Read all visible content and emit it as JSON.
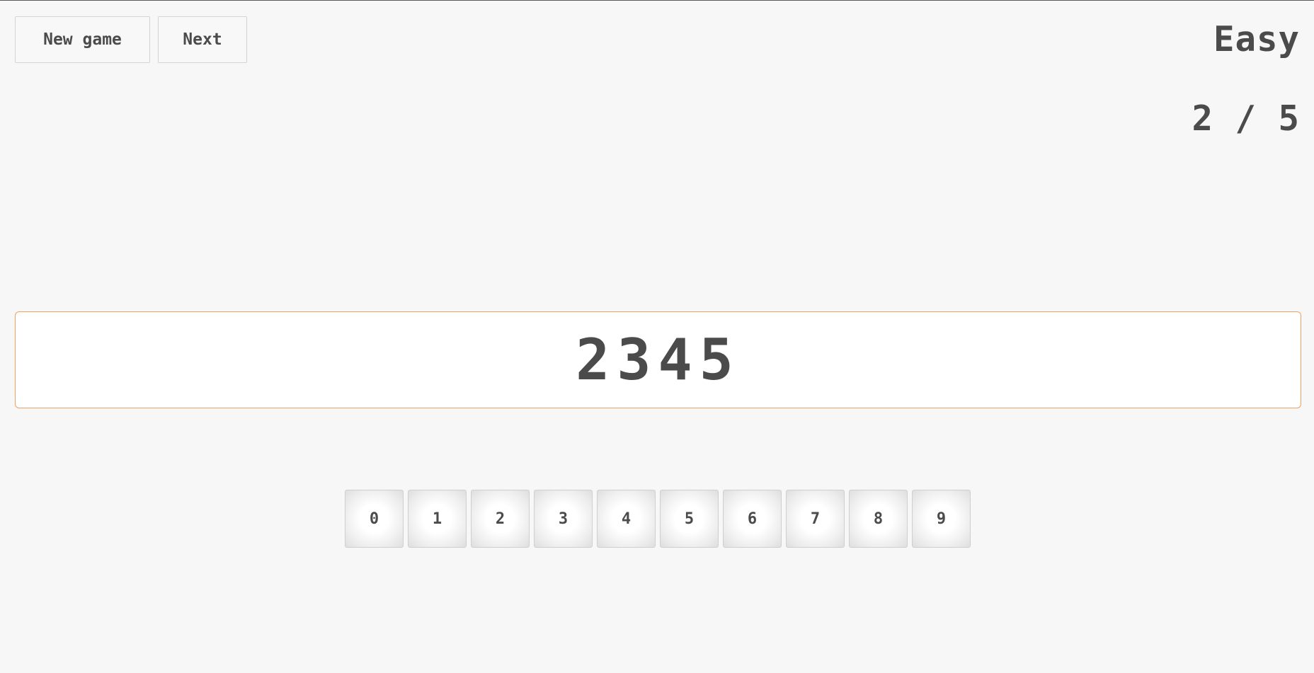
{
  "toolbar": {
    "new_game_label": "New game",
    "next_label": "Next"
  },
  "status": {
    "difficulty": "Easy",
    "progress": "2 / 5"
  },
  "display": {
    "value": "2345"
  },
  "keypad": {
    "keys": [
      "0",
      "1",
      "2",
      "3",
      "4",
      "5",
      "6",
      "7",
      "8",
      "9"
    ]
  },
  "colors": {
    "background": "#f7f7f7",
    "text": "#4b4b4b",
    "display_border": "#f0a060"
  }
}
